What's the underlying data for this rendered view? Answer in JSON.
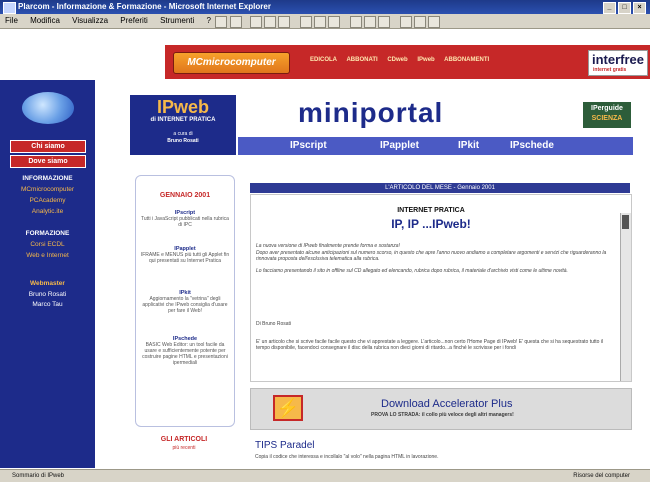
{
  "window": {
    "title": "Plarcom - Informazione & Formazione - Microsoft Internet Explorer",
    "menu": [
      "File",
      "Modifica",
      "Visualizza",
      "Preferiti",
      "Strumenti",
      "?"
    ]
  },
  "banner": {
    "logo_text": "MCmicrocomputer",
    "links": [
      "EDICOLA",
      "ABBONATI",
      "CDweb",
      "IPweb",
      "ABBONAMENTI"
    ],
    "interfree_big": "interfree",
    "interfree_small": "internet gratis"
  },
  "sidebar": {
    "buttons": [
      "Chi siamo",
      "Dove siamo"
    ],
    "sections": [
      {
        "head": "INFORMAZIONE",
        "items": [
          "MCmicrocomputer",
          "PCAcademy",
          "Analytic.ite"
        ]
      },
      {
        "head": "FORMAZIONE",
        "items": [
          "Corsi ECDL",
          "Web e Internet"
        ]
      },
      {
        "head": "Webmaster",
        "items": [
          "Bruno Rosati",
          "Marco Tau"
        ]
      }
    ]
  },
  "ipweb": {
    "logo": "IPweb",
    "subtitle": "di INTERNET PRATICA",
    "by": "a cura di",
    "author": "Bruno Rosati"
  },
  "miniportal": {
    "title": "miniportal",
    "badge_line1": "IPerguide",
    "badge_line2": "SCIENZA",
    "nav": [
      "IPscript",
      "IPapplet",
      "IPkit",
      "IPschede"
    ]
  },
  "gennaio": {
    "title": "GENNAIO 2001",
    "sections": [
      {
        "title": "IPscript",
        "desc": "Tutti i JavaScript pubblicati nella rubrica di IPC"
      },
      {
        "title": "IPapplet",
        "desc": "IFRAME e MENUS più tutti gli Applet fin qui presentati su Internet Pratica"
      },
      {
        "title": "IPkit",
        "desc": "Aggiornamento la \"vetrina\" degli applicativi che IPweb consiglia d'usare per fare il Web!"
      },
      {
        "title": "IPschede",
        "desc": "BASIC Web Editor: un tool facile da usare e sufficientemente potente per costruire pagine HTML e presentazioni ipermediali"
      }
    ],
    "footer": "GLI ARTICOLI",
    "footer_sub": "più recenti"
  },
  "article": {
    "header": "L'ARTICOLO DEL MESE - Gennaio 2001",
    "kicker": "INTERNET PRATICA",
    "title": "IP, IP ...IPweb!",
    "paragraphs": [
      "La nuova versione di IPweb finalmente prende forma e sostanza!",
      "Dopo aver presentato alcune anticipazioni sul numero scorso, in questo che apre l'anno nuovo andiamo a completare argomenti e servizi che riguarderanno la rinnovata proposta dell'esclusiva telematica alla rubrica.",
      "Lo facciamo presentando il sito in offline sul CD allegato ed elencando, rubrica dopo rubrica, il materiale d'archivio visti come le ultime novità.",
      "Di Bruno Rosati",
      "E' un articolo che si scrive facile facile questo che vi apprestate a leggere. L'articolo...non certo l'Home Page di IPweb! E' questa che si ha sequestrato tutto il tempo disponibile, facendoci consegnare il disc della rubrica non dieci giorni di ritardo...a finché le scrivisse per i fondi"
    ]
  },
  "download": {
    "title": "Download Accelerator Plus",
    "subtitle": "PROVA LO STRADA: il collo più veloce degli altri managers!"
  },
  "tips": {
    "title": "TIPS Paradel",
    "desc": "Copia il codice che interessa e incollalo \"al volo\" nella pagina HTML in lavorazione."
  },
  "status": {
    "left": "Sommario di IPweb",
    "right": "Risorse del computer"
  }
}
